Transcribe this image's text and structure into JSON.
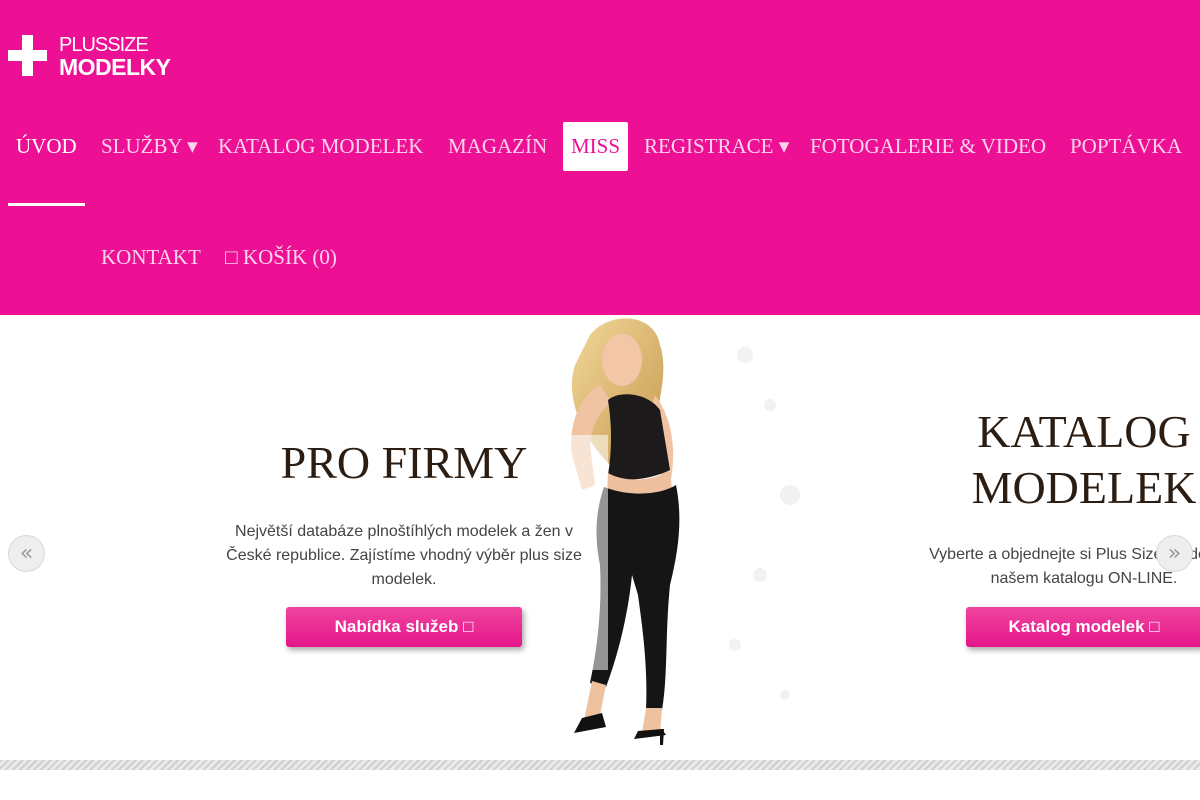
{
  "logo": {
    "line1": "PLUSSIZE",
    "line2": "MODELKY"
  },
  "nav": {
    "items": [
      {
        "label": "ÚVOD"
      },
      {
        "label": "SLUŽBY ▾"
      },
      {
        "label": "KATALOG MODELEK"
      },
      {
        "label": "MAGAZÍN"
      },
      {
        "label": "MISS"
      },
      {
        "label": "REGISTRACE ▾"
      },
      {
        "label": "FOTOGALERIE & VIDEO"
      },
      {
        "label": "POPTÁVKA"
      },
      {
        "label": "KONTAKT"
      },
      {
        "label": "□ KOŠÍK (0)"
      }
    ]
  },
  "slides": [
    {
      "title": "PRO FIRMY",
      "text": "Největší databáze plnoštíhlých modelek a žen v České republice. Zajístíme vhodný výběr plus size modelek.",
      "button": "Nabídka služeb  □"
    },
    {
      "title_line1": "KATALOG",
      "title_line2": "MODELEK",
      "text_line1": "Vyberte a objednejte si Plus Size modelky v",
      "text_line2": "našem katalogu ON-LINE.",
      "button": "Katalog modelek  □"
    }
  ],
  "slider": {
    "prev": "«",
    "next": "»"
  },
  "colors": {
    "brand": "#ed1094",
    "title": "#2c1d12"
  }
}
